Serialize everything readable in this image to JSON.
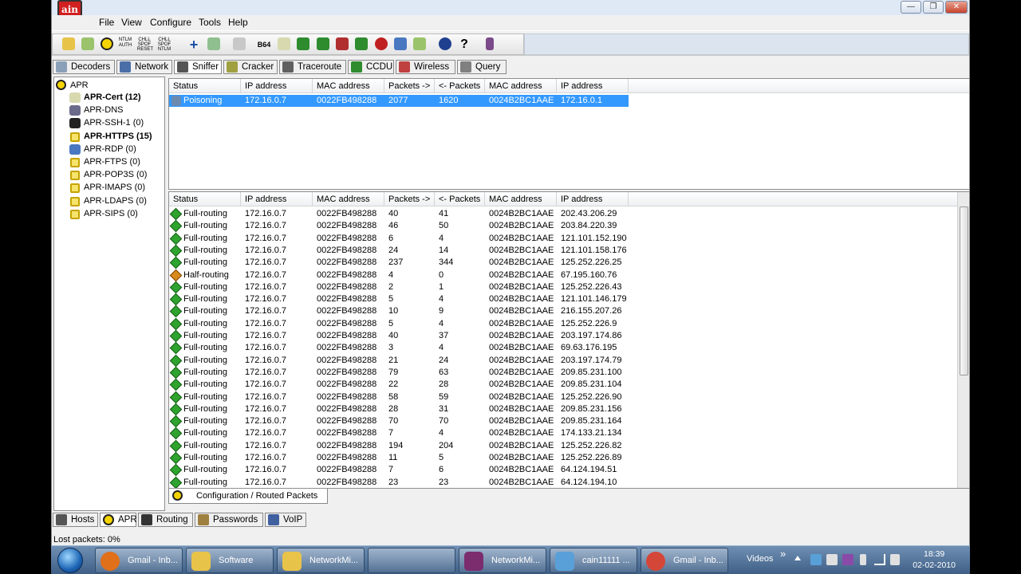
{
  "window": {
    "logo_text": "ain",
    "buttons": {
      "minimize": "—",
      "maximize": "❐",
      "close": "✕"
    }
  },
  "menu": [
    "File",
    "View",
    "Configure",
    "Tools",
    "Help"
  ],
  "toolbar": {
    "icons": [
      "open-icon",
      "save-icon",
      "nuke-icon",
      "ntlm-icon",
      "snmp-reset-icon",
      "ntlm-spoof-icon",
      "plus-icon",
      "recycle-icon",
      "copy-icon",
      "base64-icon",
      "certificate-icon",
      "hash1-icon",
      "hash2-icon",
      "dc-icon",
      "monitor-icon",
      "record-icon",
      "wireless-icon",
      "pen-icon",
      "info-icon",
      "help-icon",
      "exit-icon"
    ],
    "labels": {
      "ntlm": "NTLM AUTH",
      "snmp": "CHLL SPOF RESET",
      "spoof": "CHLL SPOF NTLM",
      "base64": "B64"
    }
  },
  "top_tabs": [
    {
      "label": "Decoders",
      "icon": "decoder-icon"
    },
    {
      "label": "Network",
      "icon": "network-icon"
    },
    {
      "label": "Sniffer",
      "icon": "sniffer-icon"
    },
    {
      "label": "Cracker",
      "icon": "cracker-icon"
    },
    {
      "label": "Traceroute",
      "icon": "traceroute-icon"
    },
    {
      "label": "CCDU",
      "icon": "ccdu-icon"
    },
    {
      "label": "Wireless",
      "icon": "wireless-icon"
    },
    {
      "label": "Query",
      "icon": "query-icon"
    }
  ],
  "tree": {
    "root": "APR",
    "items": [
      {
        "label": "APR-Cert (12)",
        "bold": true,
        "icon": "certificate-icon"
      },
      {
        "label": "APR-DNS",
        "bold": false,
        "icon": "dns-icon"
      },
      {
        "label": "APR-SSH-1 (0)",
        "bold": false,
        "icon": "terminal-icon"
      },
      {
        "label": "APR-HTTPS (15)",
        "bold": true,
        "icon": "lock-icon"
      },
      {
        "label": "APR-RDP (0)",
        "bold": false,
        "icon": "rdp-icon"
      },
      {
        "label": "APR-FTPS (0)",
        "bold": false,
        "icon": "lock-icon"
      },
      {
        "label": "APR-POP3S (0)",
        "bold": false,
        "icon": "lock-icon"
      },
      {
        "label": "APR-IMAPS (0)",
        "bold": false,
        "icon": "lock-icon"
      },
      {
        "label": "APR-LDAPS (0)",
        "bold": false,
        "icon": "lock-icon"
      },
      {
        "label": "APR-SIPS (0)",
        "bold": false,
        "icon": "lock-icon"
      }
    ]
  },
  "columns": [
    "Status",
    "IP address",
    "MAC address",
    "Packets ->",
    "<- Packets",
    "MAC address",
    "IP address"
  ],
  "top_rows": [
    {
      "status": "Poisoning",
      "ip1": "172.16.0.7",
      "mac1": "0022FB498288",
      "out": "2077",
      "in": "1620",
      "mac2": "0024B2BC1AAE",
      "ip2": "172.16.0.1"
    }
  ],
  "bottom_rows": [
    {
      "status": "Full-routing",
      "ip1": "172.16.0.7",
      "mac1": "0022FB498288",
      "out": "40",
      "in": "41",
      "mac2": "0024B2BC1AAE",
      "ip2": "202.43.206.29"
    },
    {
      "status": "Full-routing",
      "ip1": "172.16.0.7",
      "mac1": "0022FB498288",
      "out": "46",
      "in": "50",
      "mac2": "0024B2BC1AAE",
      "ip2": "203.84.220.39"
    },
    {
      "status": "Full-routing",
      "ip1": "172.16.0.7",
      "mac1": "0022FB498288",
      "out": "6",
      "in": "4",
      "mac2": "0024B2BC1AAE",
      "ip2": "121.101.152.190"
    },
    {
      "status": "Full-routing",
      "ip1": "172.16.0.7",
      "mac1": "0022FB498288",
      "out": "24",
      "in": "14",
      "mac2": "0024B2BC1AAE",
      "ip2": "121.101.158.176"
    },
    {
      "status": "Full-routing",
      "ip1": "172.16.0.7",
      "mac1": "0022FB498288",
      "out": "237",
      "in": "344",
      "mac2": "0024B2BC1AAE",
      "ip2": "125.252.226.25"
    },
    {
      "status": "Half-routing",
      "ip1": "172.16.0.7",
      "mac1": "0022FB498288",
      "out": "4",
      "in": "0",
      "mac2": "0024B2BC1AAE",
      "ip2": "67.195.160.76"
    },
    {
      "status": "Full-routing",
      "ip1": "172.16.0.7",
      "mac1": "0022FB498288",
      "out": "2",
      "in": "1",
      "mac2": "0024B2BC1AAE",
      "ip2": "125.252.226.43"
    },
    {
      "status": "Full-routing",
      "ip1": "172.16.0.7",
      "mac1": "0022FB498288",
      "out": "5",
      "in": "4",
      "mac2": "0024B2BC1AAE",
      "ip2": "121.101.146.179"
    },
    {
      "status": "Full-routing",
      "ip1": "172.16.0.7",
      "mac1": "0022FB498288",
      "out": "10",
      "in": "9",
      "mac2": "0024B2BC1AAE",
      "ip2": "216.155.207.26"
    },
    {
      "status": "Full-routing",
      "ip1": "172.16.0.7",
      "mac1": "0022FB498288",
      "out": "5",
      "in": "4",
      "mac2": "0024B2BC1AAE",
      "ip2": "125.252.226.9"
    },
    {
      "status": "Full-routing",
      "ip1": "172.16.0.7",
      "mac1": "0022FB498288",
      "out": "40",
      "in": "37",
      "mac2": "0024B2BC1AAE",
      "ip2": "203.197.174.86"
    },
    {
      "status": "Full-routing",
      "ip1": "172.16.0.7",
      "mac1": "0022FB498288",
      "out": "3",
      "in": "4",
      "mac2": "0024B2BC1AAE",
      "ip2": "69.63.176.195"
    },
    {
      "status": "Full-routing",
      "ip1": "172.16.0.7",
      "mac1": "0022FB498288",
      "out": "21",
      "in": "24",
      "mac2": "0024B2BC1AAE",
      "ip2": "203.197.174.79"
    },
    {
      "status": "Full-routing",
      "ip1": "172.16.0.7",
      "mac1": "0022FB498288",
      "out": "79",
      "in": "63",
      "mac2": "0024B2BC1AAE",
      "ip2": "209.85.231.100"
    },
    {
      "status": "Full-routing",
      "ip1": "172.16.0.7",
      "mac1": "0022FB498288",
      "out": "22",
      "in": "28",
      "mac2": "0024B2BC1AAE",
      "ip2": "209.85.231.104"
    },
    {
      "status": "Full-routing",
      "ip1": "172.16.0.7",
      "mac1": "0022FB498288",
      "out": "58",
      "in": "59",
      "mac2": "0024B2BC1AAE",
      "ip2": "125.252.226.90"
    },
    {
      "status": "Full-routing",
      "ip1": "172.16.0.7",
      "mac1": "0022FB498288",
      "out": "28",
      "in": "31",
      "mac2": "0024B2BC1AAE",
      "ip2": "209.85.231.156"
    },
    {
      "status": "Full-routing",
      "ip1": "172.16.0.7",
      "mac1": "0022FB498288",
      "out": "70",
      "in": "70",
      "mac2": "0024B2BC1AAE",
      "ip2": "209.85.231.164"
    },
    {
      "status": "Full-routing",
      "ip1": "172.16.0.7",
      "mac1": "0022FB498288",
      "out": "7",
      "in": "4",
      "mac2": "0024B2BC1AAE",
      "ip2": "174.133.21.134"
    },
    {
      "status": "Full-routing",
      "ip1": "172.16.0.7",
      "mac1": "0022FB498288",
      "out": "194",
      "in": "204",
      "mac2": "0024B2BC1AAE",
      "ip2": "125.252.226.82"
    },
    {
      "status": "Full-routing",
      "ip1": "172.16.0.7",
      "mac1": "0022FB498288",
      "out": "11",
      "in": "5",
      "mac2": "0024B2BC1AAE",
      "ip2": "125.252.226.89"
    },
    {
      "status": "Full-routing",
      "ip1": "172.16.0.7",
      "mac1": "0022FB498288",
      "out": "7",
      "in": "6",
      "mac2": "0024B2BC1AAE",
      "ip2": "64.124.194.51"
    },
    {
      "status": "Full-routing",
      "ip1": "172.16.0.7",
      "mac1": "0022FB498288",
      "out": "23",
      "in": "23",
      "mac2": "0024B2BC1AAE",
      "ip2": "64.124.194.10"
    }
  ],
  "sub_tab": "Configuration / Routed Packets",
  "bottom_tabs": [
    {
      "label": "Hosts",
      "icon": "hosts-icon",
      "active": false
    },
    {
      "label": "APR",
      "icon": "nuke-icon",
      "active": true
    },
    {
      "label": "Routing",
      "icon": "routing-icon",
      "active": false
    },
    {
      "label": "Passwords",
      "icon": "key-icon",
      "active": false
    },
    {
      "label": "VoIP",
      "icon": "voip-icon",
      "active": false
    }
  ],
  "status": {
    "lost_packets": "Lost packets:  0%"
  },
  "taskbar": {
    "tasks": [
      {
        "label": "Gmail - Inb...",
        "icon": "firefox-icon",
        "color": "#e0701a"
      },
      {
        "label": "Software",
        "icon": "folder-icon",
        "color": "#e8c34a"
      },
      {
        "label": "NetworkMi...",
        "icon": "folder-icon",
        "color": "#e8c34a"
      },
      {
        "label": "",
        "icon": "blank-icon",
        "color": "#6f8fb3"
      },
      {
        "label": "NetworkMi...",
        "icon": "networkminer-icon",
        "color": "#7b2d6e"
      },
      {
        "label": "cain11111 ...",
        "icon": "paint-icon",
        "color": "#5aa0d8"
      },
      {
        "label": "Gmail - Inb...",
        "icon": "chrome-icon",
        "color": "#d44638"
      }
    ],
    "videos": "Videos",
    "chevron": "»",
    "time": "18:39",
    "date": "02-02-2010"
  },
  "colors": {
    "selection": "#3399ff",
    "full_routing": "#2ea32e",
    "half_routing": "#d88a1a"
  }
}
